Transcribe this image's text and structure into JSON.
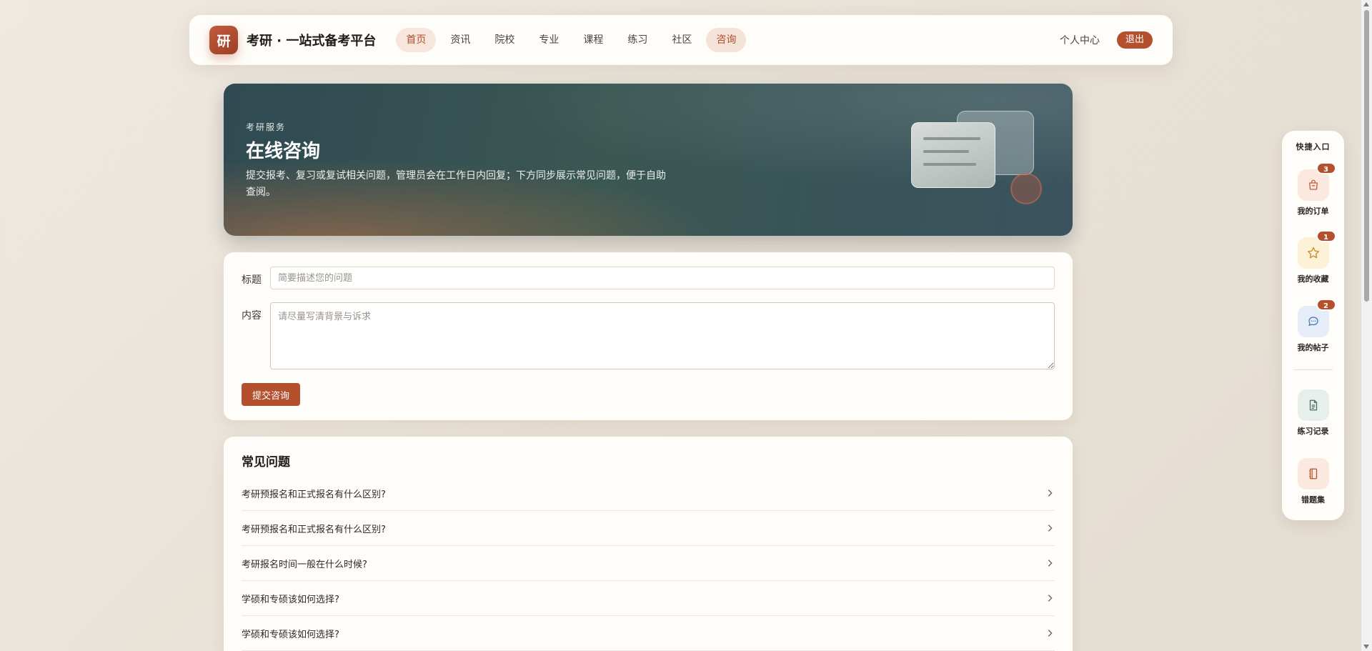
{
  "nav": {
    "logo_char": "研",
    "brand": "考研 · 一站式备考平台",
    "links": [
      {
        "label": "首页"
      },
      {
        "label": "资讯"
      },
      {
        "label": "院校"
      },
      {
        "label": "专业"
      },
      {
        "label": "课程"
      },
      {
        "label": "练习"
      },
      {
        "label": "社区"
      },
      {
        "label": "咨询"
      }
    ],
    "user_center": "个人中心",
    "logout": "退出"
  },
  "hero": {
    "eyebrow": "考研服务",
    "title": "在线咨询",
    "description": "提交报考、复习或复试相关问题，管理员会在工作日内回复；下方同步展示常见问题，便于自助查阅。"
  },
  "form": {
    "title_label": "标题",
    "title_placeholder": "简要描述您的问题",
    "title_value": "",
    "content_label": "内容",
    "content_placeholder": "请尽量写清背景与诉求",
    "content_value": "",
    "submit_label": "提交咨询"
  },
  "faq": {
    "title": "常见问题",
    "items": [
      {
        "question": "考研预报名和正式报名有什么区别?"
      },
      {
        "question": "考研预报名和正式报名有什么区别?"
      },
      {
        "question": "考研报名时间一般在什么时候?"
      },
      {
        "question": "学硕和专硕该如何选择?"
      },
      {
        "question": "学硕和专硕该如何选择?"
      }
    ]
  },
  "quick": {
    "title": "快捷入口",
    "items": [
      {
        "label": "我的订单",
        "badge": "3",
        "icon": "shopping-bag-icon",
        "color": "#c0603f",
        "bg": "#fbe9df"
      },
      {
        "label": "我的收藏",
        "badge": "1",
        "icon": "star-icon",
        "color": "#c8922a",
        "bg": "#fdf1d8"
      },
      {
        "label": "我的帖子",
        "badge": "2",
        "icon": "chat-bubble-icon",
        "color": "#4a78b5",
        "bg": "#e4edf8"
      },
      {
        "label": "练习记录",
        "icon": "document-icon",
        "color": "#4f6f64",
        "bg": "#e6efeb"
      },
      {
        "label": "错题集",
        "icon": "notebook-icon",
        "color": "#b5502f",
        "bg": "#fbe9df"
      }
    ]
  },
  "colors": {
    "accent": "#b5502f",
    "hero_start": "#2f4a52",
    "hero_end": "#3a535e"
  }
}
